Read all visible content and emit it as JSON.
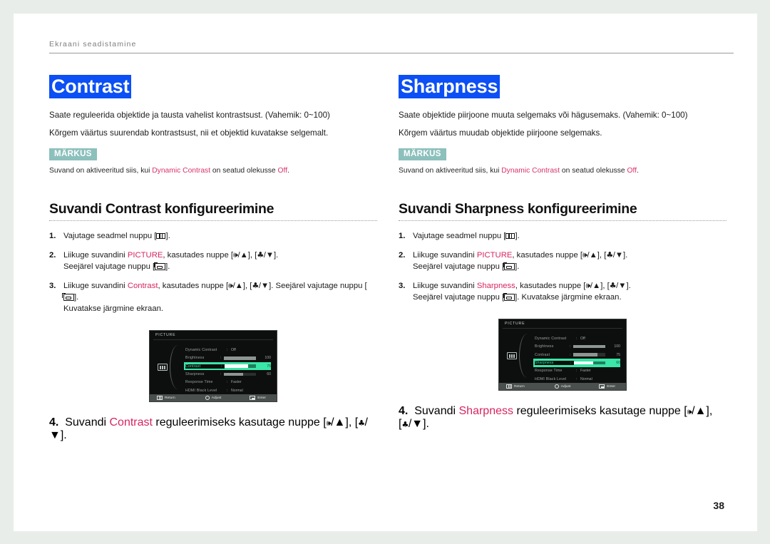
{
  "header": {
    "running_head": "Ekraani seadistamine"
  },
  "page_number": "38",
  "columns": [
    {
      "title": "Contrast",
      "desc_line1": "Saate reguleerida objektide ja tausta vahelist kontrastsust. (Vahemik: 0~100)",
      "desc_line2": "Kõrgem väärtus suurendab kontrastsust, nii et objektid kuvatakse selgemalt.",
      "note_badge": "MÄRKUS",
      "note_pre": "Suvand on aktiveeritud siis, kui ",
      "note_link": "Dynamic Contrast",
      "note_mid": " on seatud olekusse ",
      "note_value": "Off",
      "note_end": ".",
      "section_heading": "Suvandi Contrast konfigureerimine",
      "steps": [
        {
          "pre": "Vajutage seadmel nuppu [",
          "post": "]."
        },
        {
          "a": "Liikuge suvandini ",
          "option": "PICTURE",
          "b": ", kasutades nuppe [",
          "c": "/▲], [",
          "d": "/▼].",
          "e": "Seejärel vajutage nuppu [",
          "f": "]."
        },
        {
          "a": "Liikuge suvandini ",
          "option": "Contrast",
          "b": ", kasutades nuppe [",
          "c": "/▲], [",
          "d": "/▼]. Seejärel vajutage nuppu [",
          "e": "].",
          "f": "Kuvatakse järgmine ekraan."
        }
      ],
      "step4": {
        "a": "Suvandi ",
        "option": "Contrast",
        "b": " reguleerimiseks kasutage nuppe [",
        "c": "/▲], [",
        "d": "/▼]."
      },
      "osd": {
        "title": "PICTURE",
        "rows": [
          {
            "label": "Dynamic Contrast",
            "type": "text",
            "value": "Off"
          },
          {
            "label": "Brightness",
            "type": "bar",
            "percent": 100,
            "number": "100"
          },
          {
            "label": "Contrast",
            "type": "bar",
            "percent": 75,
            "number": "75",
            "selected": true
          },
          {
            "label": "Sharpness",
            "type": "bar",
            "percent": 60,
            "number": "60"
          },
          {
            "label": "Response Time",
            "type": "text",
            "value": "Faster"
          },
          {
            "label": "HDMI Black Level",
            "type": "text",
            "value": "Normal"
          }
        ],
        "footer": [
          {
            "icon": "menu-icon",
            "label": "Return"
          },
          {
            "icon": "jog-icon",
            "label": "Adjust"
          },
          {
            "icon": "enter-icon",
            "label": "Enter"
          }
        ]
      }
    },
    {
      "title": "Sharpness",
      "desc_line1": "Saate objektide piirjoone muuta selgemaks või hägusemaks. (Vahemik: 0~100)",
      "desc_line2": "Kõrgem väärtus muudab objektide piirjoone selgemaks.",
      "note_badge": "MÄRKUS",
      "note_pre": "Suvand on aktiveeritud siis, kui ",
      "note_link": "Dynamic Contrast",
      "note_mid": " on seatud olekusse ",
      "note_value": "Off",
      "note_end": ".",
      "section_heading": "Suvandi Sharpness konfigureerimine",
      "steps": [
        {
          "pre": "Vajutage seadmel nuppu [",
          "post": "]."
        },
        {
          "a": "Liikuge suvandini ",
          "option": "PICTURE",
          "b": ", kasutades nuppe [",
          "c": "/▲], [",
          "d": "/▼].",
          "e": "Seejärel vajutage nuppu [",
          "f": "]."
        },
        {
          "a": "Liikuge suvandini ",
          "option": "Sharpness",
          "b": ", kasutades nuppe [",
          "c": "/▲], [",
          "d": "/▼].",
          "e": "Seejärel vajutage nuppu [",
          "f": "]. Kuvatakse järgmine ekraan."
        }
      ],
      "step4": {
        "a": "Suvandi ",
        "option": "Sharpness",
        "b": " reguleerimiseks kasutage nuppe [",
        "c": "/▲], [",
        "d": "/▼]."
      },
      "osd": {
        "title": "PICTURE",
        "rows": [
          {
            "label": "Dynamic Contrast",
            "type": "text",
            "value": "Off"
          },
          {
            "label": "Brightness",
            "type": "bar",
            "percent": 100,
            "number": "100"
          },
          {
            "label": "Contrast",
            "type": "bar",
            "percent": 75,
            "number": "75"
          },
          {
            "label": "Sharpness",
            "type": "bar",
            "percent": 60,
            "number": "60",
            "selected": true
          },
          {
            "label": "Response Time",
            "type": "text",
            "value": "Faster"
          },
          {
            "label": "HDMI Black Level",
            "type": "text",
            "value": "Normal"
          }
        ],
        "footer": [
          {
            "icon": "menu-icon",
            "label": "Return"
          },
          {
            "icon": "jog-icon",
            "label": "Adjust"
          },
          {
            "icon": "enter-icon",
            "label": "Enter"
          }
        ]
      }
    }
  ]
}
